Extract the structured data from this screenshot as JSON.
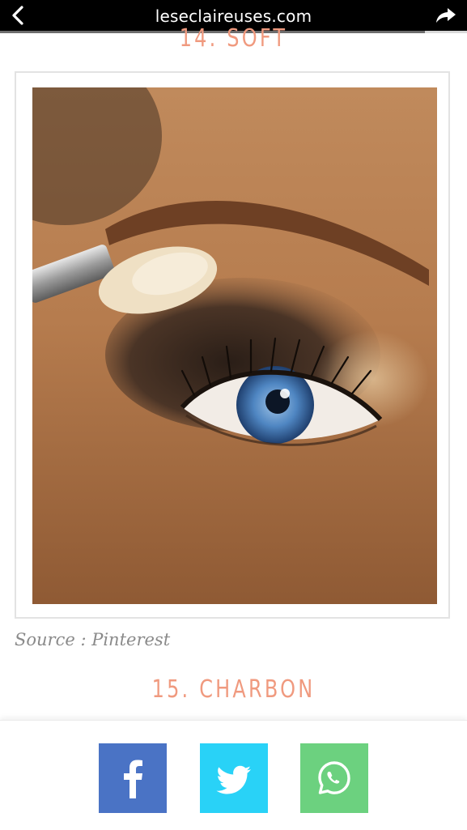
{
  "browser": {
    "url": "leseclaireuses.com",
    "back_icon": "chevron-left-icon",
    "share_icon": "share-arrow-icon",
    "progress": 0.91
  },
  "article": {
    "heading_prev": "14. SOFT",
    "heading_next": "15. CHARBON",
    "source": "Source : Pinterest"
  },
  "share_bar": {
    "buttons": [
      {
        "name": "facebook",
        "icon": "facebook-icon",
        "color": "#4a73c5"
      },
      {
        "name": "twitter",
        "icon": "twitter-icon",
        "color": "#29d2f7"
      },
      {
        "name": "whatsapp",
        "icon": "whatsapp-icon",
        "color": "#6cd17f"
      }
    ]
  }
}
